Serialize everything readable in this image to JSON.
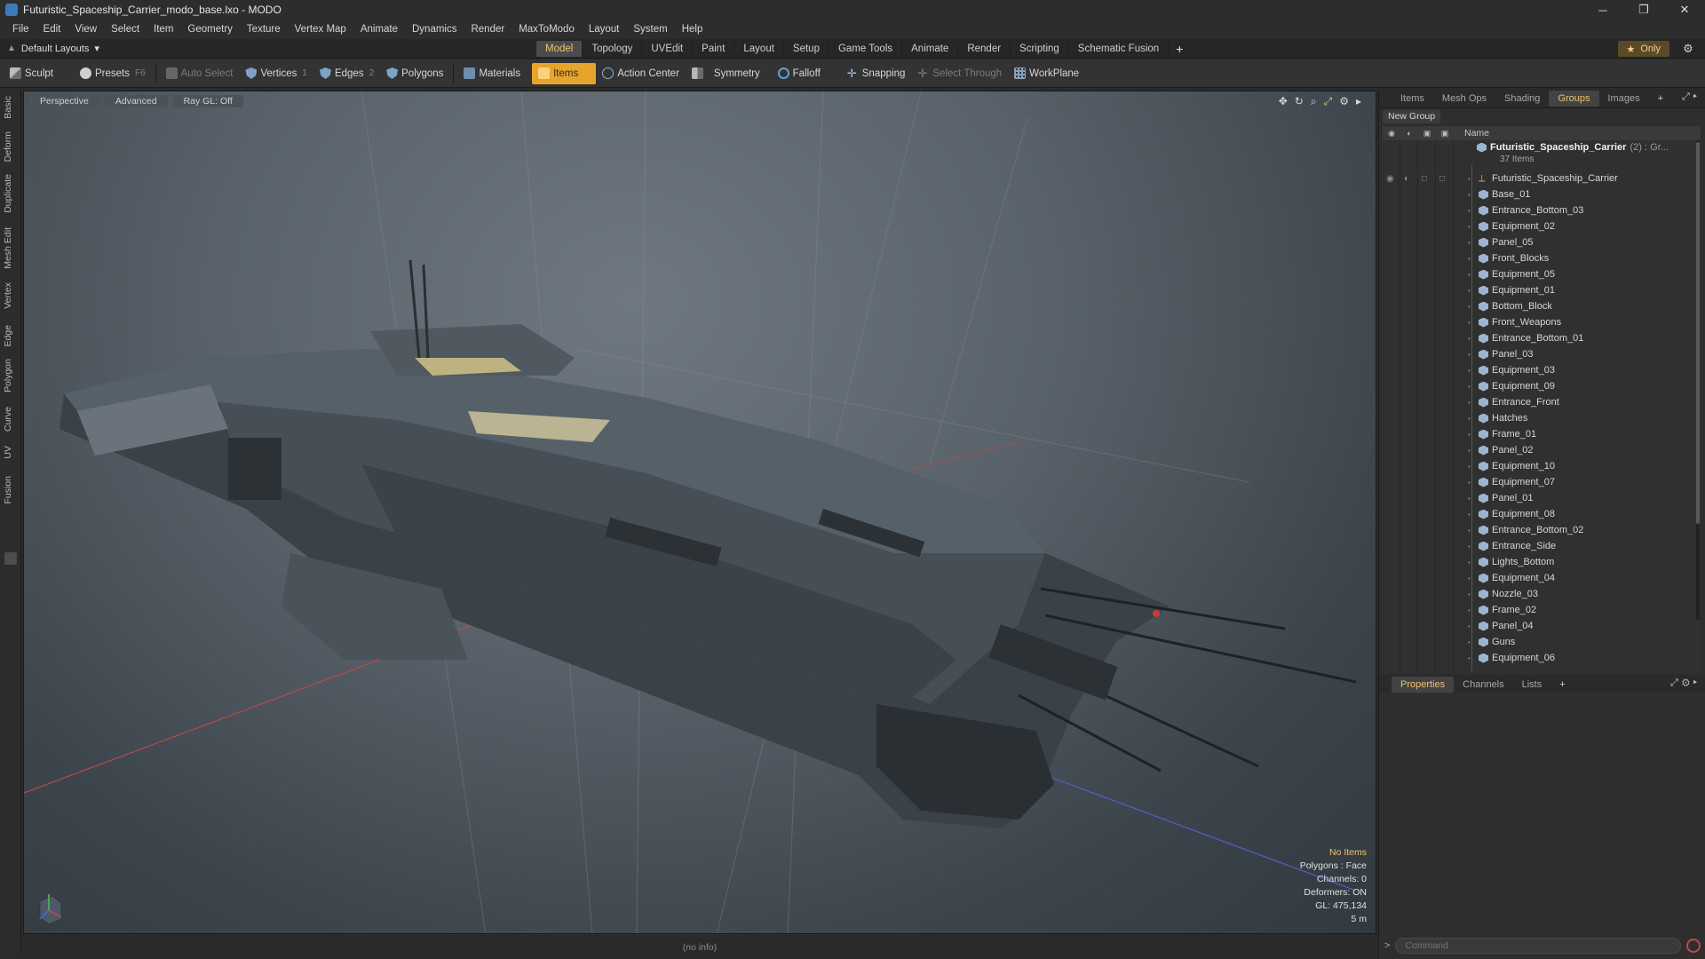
{
  "window": {
    "title": "Futuristic_Spaceship_Carrier_modo_base.lxo - MODO",
    "controls": [
      "─",
      "❐",
      "✕"
    ]
  },
  "menu": [
    "File",
    "Edit",
    "View",
    "Select",
    "Item",
    "Geometry",
    "Texture",
    "Vertex Map",
    "Animate",
    "Dynamics",
    "Render",
    "MaxToModo",
    "Layout",
    "System",
    "Help"
  ],
  "layouts": {
    "selected": "Default Layouts",
    "tabs": [
      "Model",
      "Topology",
      "UVEdit",
      "Paint",
      "Layout",
      "Setup",
      "Game Tools",
      "Animate",
      "Render",
      "Scripting",
      "Schematic Fusion"
    ],
    "active_tab": "Model",
    "plus": "+",
    "only_label": "Only"
  },
  "toolbar": {
    "sculpt": "Sculpt",
    "presets": "Presets",
    "presets_key": "F6",
    "auto_select": "Auto Select",
    "vertices": "Vertices",
    "vertices_key": "1",
    "edges": "Edges",
    "edges_key": "2",
    "polygons": "Polygons",
    "materials": "Materials",
    "items": "Items",
    "action_center": "Action Center",
    "symmetry": "Symmetry",
    "falloff": "Falloff",
    "snapping": "Snapping",
    "select_through": "Select Through",
    "workplane": "WorkPlane"
  },
  "left_tabs": [
    "Basic",
    "Deform",
    "Duplicate",
    "Mesh Edit",
    "Vertex",
    "Edge",
    "Polygon",
    "Curve",
    "UV",
    "Fusion"
  ],
  "viewport": {
    "view": "Perspective",
    "shading": "Advanced",
    "raygl": "Ray GL: Off",
    "info": {
      "selection": "No Items",
      "polygons": "Polygons : Face",
      "channels": "Channels: 0",
      "deformers": "Deformers: ON",
      "gl": "GL: 475,134",
      "scale": "5 m"
    }
  },
  "status": "(no info)",
  "right_panel": {
    "top_tabs": [
      "Items",
      "Mesh Ops",
      "Shading",
      "Groups",
      "Images"
    ],
    "active_top_tab": "Groups",
    "new_group": "New Group",
    "name_header": "Name",
    "root_group": "Futuristic_Spaceship_Carrier",
    "root_extra": "(2) : Gr...",
    "root_count": "37 Items",
    "items": [
      "Futuristic_Spaceship_Carrier",
      "Base_01",
      "Entrance_Bottom_03",
      "Equipment_02",
      "Panel_05",
      "Front_Blocks",
      "Equipment_05",
      "Equipment_01",
      "Bottom_Block",
      "Front_Weapons",
      "Entrance_Bottom_01",
      "Panel_03",
      "Equipment_03",
      "Equipment_09",
      "Entrance_Front",
      "Hatches",
      "Frame_01",
      "Panel_02",
      "Equipment_10",
      "Equipment_07",
      "Panel_01",
      "Equipment_08",
      "Entrance_Bottom_02",
      "Entrance_Side",
      "Lights_Bottom",
      "Equipment_04",
      "Nozzle_03",
      "Frame_02",
      "Panel_04",
      "Guns",
      "Equipment_06"
    ],
    "bottom_tabs": [
      "Properties",
      "Channels",
      "Lists"
    ],
    "active_bottom_tab": "Properties",
    "command_prompt": ">",
    "command_placeholder": "Command"
  },
  "colors": {
    "accent": "#f0c36a",
    "active_items": "#e8a42a",
    "viewport_bg": "#59626a"
  }
}
